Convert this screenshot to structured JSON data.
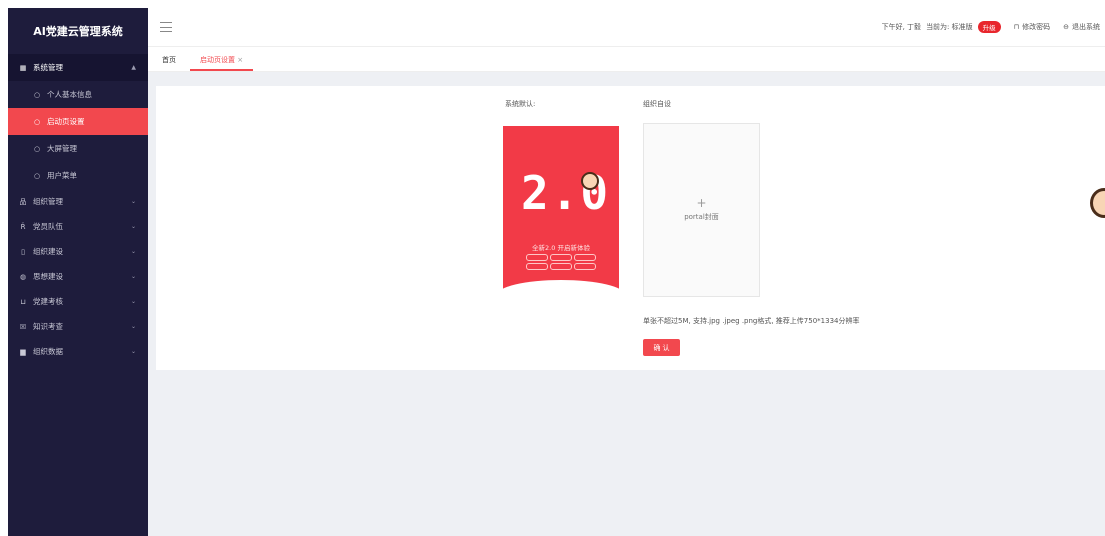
{
  "app": {
    "title": "AI党建云管理系统"
  },
  "sidebar": {
    "group": {
      "label": "系统管理",
      "icon": "grid-icon"
    },
    "subitems": [
      {
        "label": "个人基本信息",
        "active": false
      },
      {
        "label": "启动页设置",
        "active": true
      },
      {
        "label": "大屏管理",
        "active": false
      },
      {
        "label": "用户菜单",
        "active": false
      }
    ],
    "items": [
      {
        "label": "组织管理",
        "icon": "org-chart-icon"
      },
      {
        "label": "党员队伍",
        "icon": "person-icon"
      },
      {
        "label": "组织建设",
        "icon": "document-icon"
      },
      {
        "label": "思想建设",
        "icon": "globe-icon"
      },
      {
        "label": "党建考核",
        "icon": "bar-chart-icon"
      },
      {
        "label": "知识考查",
        "icon": "checklist-icon"
      },
      {
        "label": "组织数据",
        "icon": "data-icon"
      }
    ]
  },
  "header": {
    "greeting": "下午好, 丁毅",
    "edition_label": "当前为: 标准版",
    "upgrade_badge": "升级",
    "change_password": "修改密码",
    "logout": "退出系统"
  },
  "tabs": [
    {
      "label": "首页",
      "active": false
    },
    {
      "label": "启动页设置",
      "active": true,
      "close": "×"
    }
  ],
  "content": {
    "default_label": "系统默认:",
    "custom_label": "组织自设",
    "poster": {
      "big_text": "2.0",
      "caption": "全新2.0 开启新体验"
    },
    "upload": {
      "plus": "+",
      "label": "portal封面"
    },
    "hint": "单张不超过5M, 支持.jpg .jpeg .png格式, 推荐上传750*1334分辨率",
    "confirm_button": "确 认"
  },
  "colors": {
    "accent": "#f2484e",
    "sidebar": "#1e1c3c",
    "badge": "#e8262d"
  }
}
